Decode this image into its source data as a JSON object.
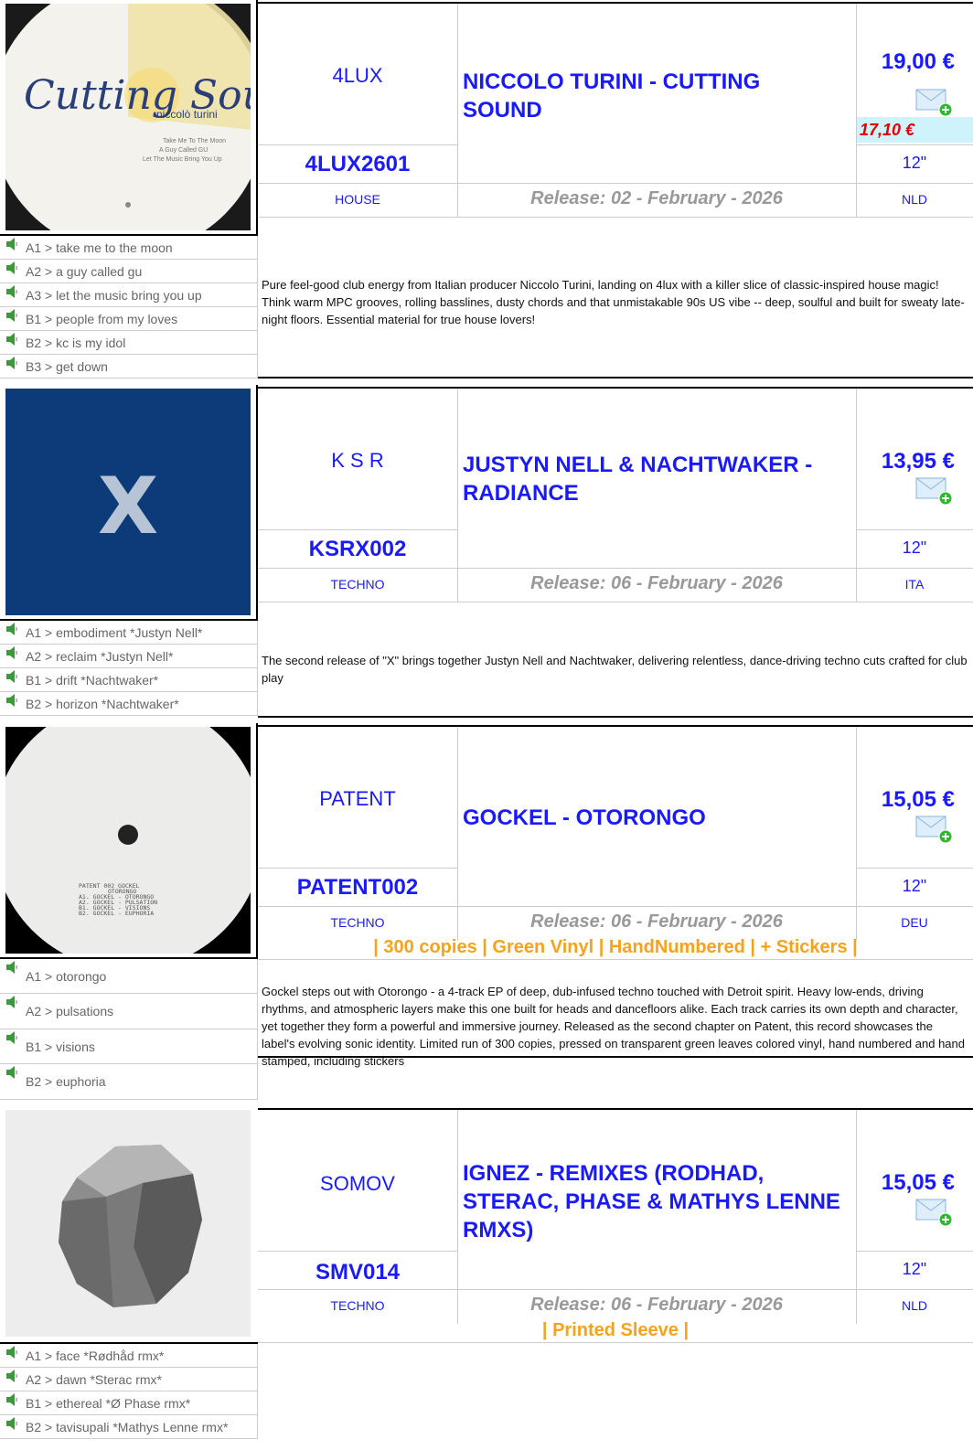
{
  "releases": [
    {
      "label": "4LUX",
      "catno": "4LUX2601",
      "title": "NICCOLO TURINI - CUTTING SOUND",
      "price": "19,00 €",
      "sale_price": "17,10 €",
      "format": "12\"",
      "genre": "HOUSE",
      "release_date": "Release: 02 - February - 2026",
      "country": "NLD",
      "notes": "",
      "cover": {
        "artist": "niccolò turini",
        "script": "Cutting Sound",
        "tracks": [
          "Take Me To The Moon",
          "A Guy Called GU",
          "Let The Music Bring You Up"
        ],
        "bg": "#f2efe6"
      },
      "tracks": [
        "A1 > take me to the moon",
        "A2 > a guy called gu",
        "A3 > let the music bring you up",
        "B1 > people from my loves",
        "B2 > kc is my idol",
        "B3 > get down"
      ],
      "description": "Pure feel-good club energy from Italian producer Niccolo Turini, landing on 4lux with a killer slice of classic-inspired house magic! Think warm MPC grooves, rolling basslines, dusty chords and that unmistakable 90s US vibe -- deep, soulful and built for sweaty late-night floors. Essential material for true house lovers!"
    },
    {
      "label": "K S R",
      "catno": "KSRX002",
      "title": "JUSTYN NELL & NACHTWAKER - RADIANCE",
      "price": "13,95 €",
      "sale_price": "",
      "format": "12\"",
      "genre": "TECHNO",
      "release_date": "Release: 06 - February - 2026",
      "country": "ITA",
      "notes": "",
      "cover": {
        "glyph": "X",
        "bg": "#0d3a78"
      },
      "tracks": [
        "A1 > embodiment *Justyn Nell*",
        "A2 > reclaim *Justyn Nell*",
        "B1 > drift *Nachtwaker*",
        "B2 > horizon *Nachtwaker*"
      ],
      "description": "The second release of \"X\" brings together Justyn Nell and Nachtwaker, delivering relentless, dance-driving techno cuts crafted for club play"
    },
    {
      "label": "PATENT",
      "catno": "PATENT002",
      "title": "GOCKEL - OTORONGO",
      "price": "15,05 €",
      "sale_price": "",
      "format": "12\"",
      "genre": "TECHNO",
      "release_date": "Release: 06 - February - 2026",
      "country": "DEU",
      "notes": "| 300 copies | Green Vinyl | HandNumbered | + Stickers |",
      "cover": {
        "lines": [
          "PATENT     002     GOCKEL",
          "OTORONGO",
          "A1. GOCKEL - OTORONGO",
          "A2. GOCKEL - PULSATION",
          "B1. GOCKEL - VISIONS",
          "B2. GOCKEL - EUPHORIA"
        ],
        "bg": "#000"
      },
      "tracks": [
        "A1 > otorongo",
        "A2 > pulsations",
        "B1 > visions",
        "B2 > euphoria"
      ],
      "description": "Gockel steps out with Otorongo - a 4-track EP of deep, dub-infused techno touched with Detroit spirit. Heavy low-ends, driving rhythms, and atmospheric layers make this one built for heads and dancefloors alike. Each track carries its own depth and character, yet together they form a powerful and immersive journey. Released as the second chapter on Patent, this record showcases the label's evolving sonic identity. Limited run of 300 copies, pressed on transparent green leaves colored vinyl, hand numbered and hand stamped, including stickers"
    },
    {
      "label": "SOMOV",
      "catno": "SMV014",
      "title": "IGNEZ - REMIXES (RODHAD, STERAC, PHASE & MATHYS LENNE RMXS)",
      "price": "15,05 €",
      "sale_price": "",
      "format": "12\"",
      "genre": "TECHNO",
      "release_date": "Release: 06 - February - 2026",
      "country": "NLD",
      "notes": "| Printed Sleeve |",
      "cover": {
        "bg": "#ededed"
      },
      "tracks": [
        "A1 > face *Rødhåd rmx*",
        "A2 > dawn *Sterac rmx*",
        "B1 > ethereal *Ø Phase rmx*",
        "B2 > tavisupali *Mathys Lenne rmx*"
      ],
      "description": ""
    }
  ],
  "colors": {
    "link": "#1a1aff",
    "sale": "#e00000",
    "notes": "#f7a21b",
    "grey": "#999999"
  },
  "icons": {
    "mail": "mail-add-icon",
    "speaker": "speaker-icon"
  }
}
